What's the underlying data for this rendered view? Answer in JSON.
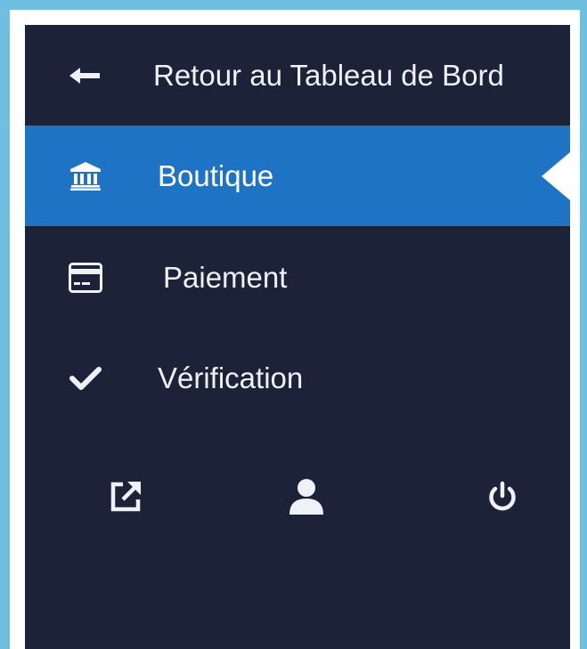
{
  "theme": {
    "frame_color": "#6fbfe0",
    "sidebar_bg": "#1c2238",
    "active_bg": "#1f73c4",
    "text_color": "#eef1f5"
  },
  "nav": {
    "back": {
      "label": "Retour au Tableau de Bord",
      "icon": "arrow-left-icon"
    },
    "items": [
      {
        "label": "Boutique",
        "icon": "bank-icon",
        "active": true
      },
      {
        "label": "Paiement",
        "icon": "credit-card-icon",
        "active": false
      },
      {
        "label": "Vérification",
        "icon": "check-icon",
        "active": false
      }
    ]
  },
  "footer_icons": [
    {
      "icon": "external-link-icon"
    },
    {
      "icon": "user-icon"
    },
    {
      "icon": "power-icon"
    }
  ]
}
